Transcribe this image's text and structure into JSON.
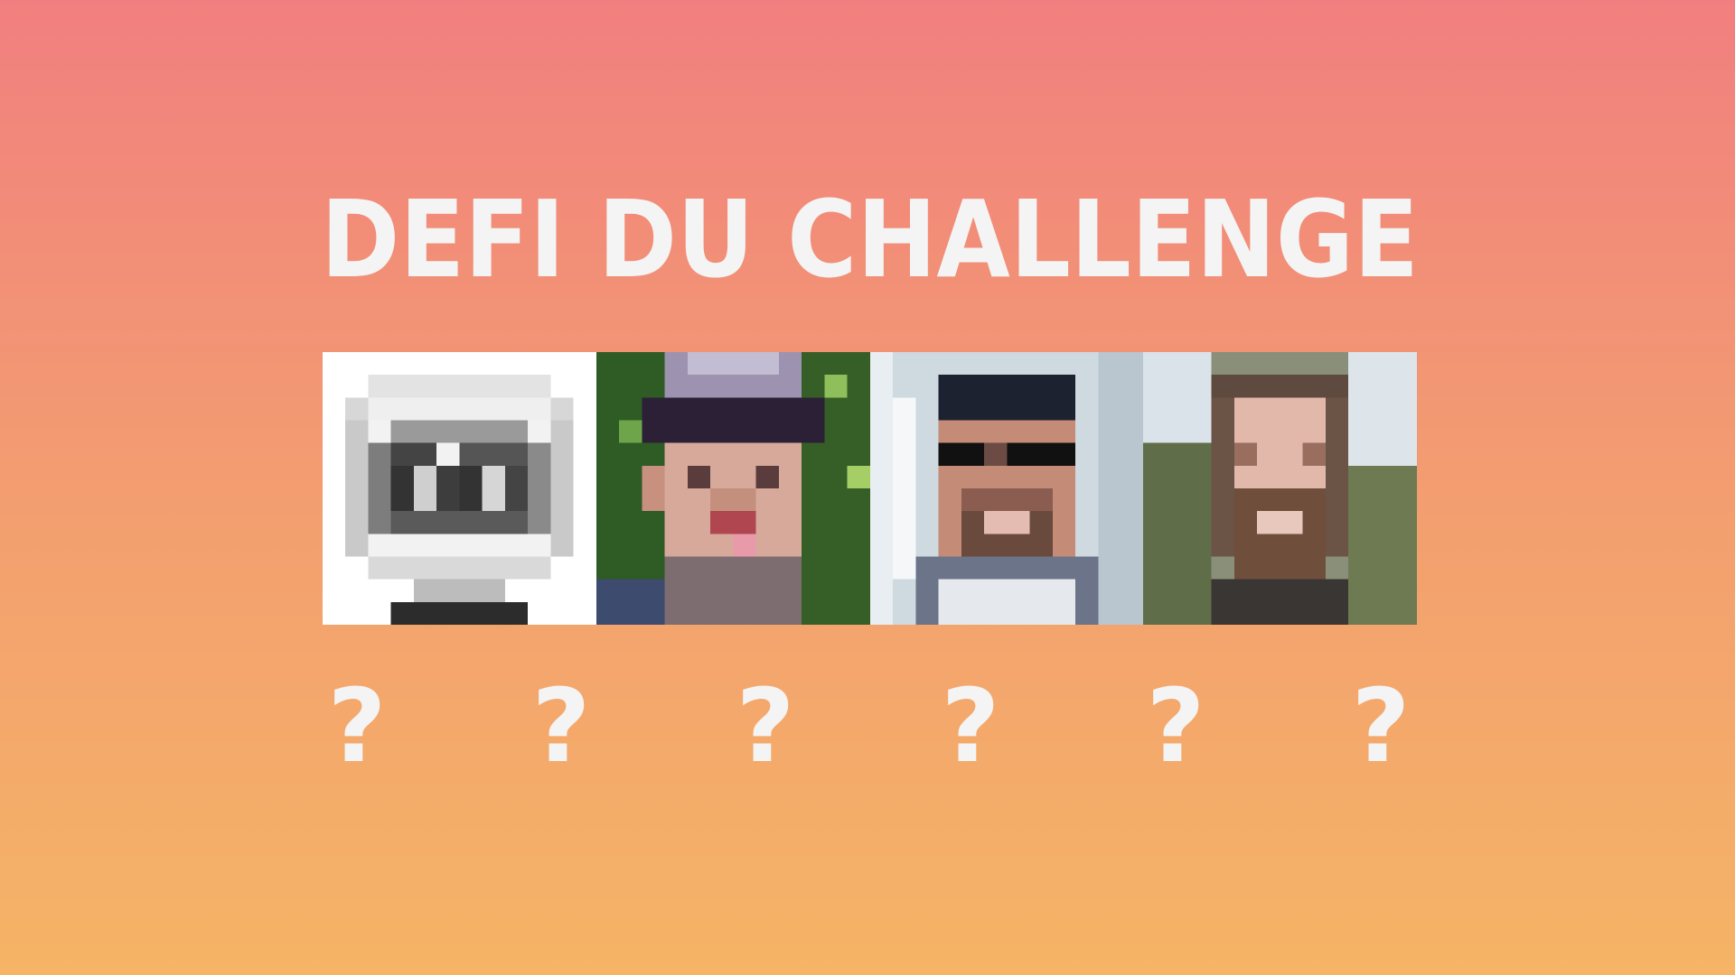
{
  "title": "DEFI DU CHALLENGE",
  "tiles": [
    {
      "name": "logo-tile",
      "icon": "pixelated-logo-icon"
    },
    {
      "name": "portrait-tile-1",
      "icon": "pixelated-face-icon"
    },
    {
      "name": "portrait-tile-2",
      "icon": "pixelated-face-icon"
    },
    {
      "name": "portrait-tile-3",
      "icon": "pixelated-face-icon"
    }
  ],
  "questions": [
    "?",
    "?",
    "?",
    "?",
    "?",
    "?"
  ],
  "colors": {
    "background_top": "#f17f7f",
    "background_bottom": "#f5b466",
    "text": "#f4f4f4"
  }
}
